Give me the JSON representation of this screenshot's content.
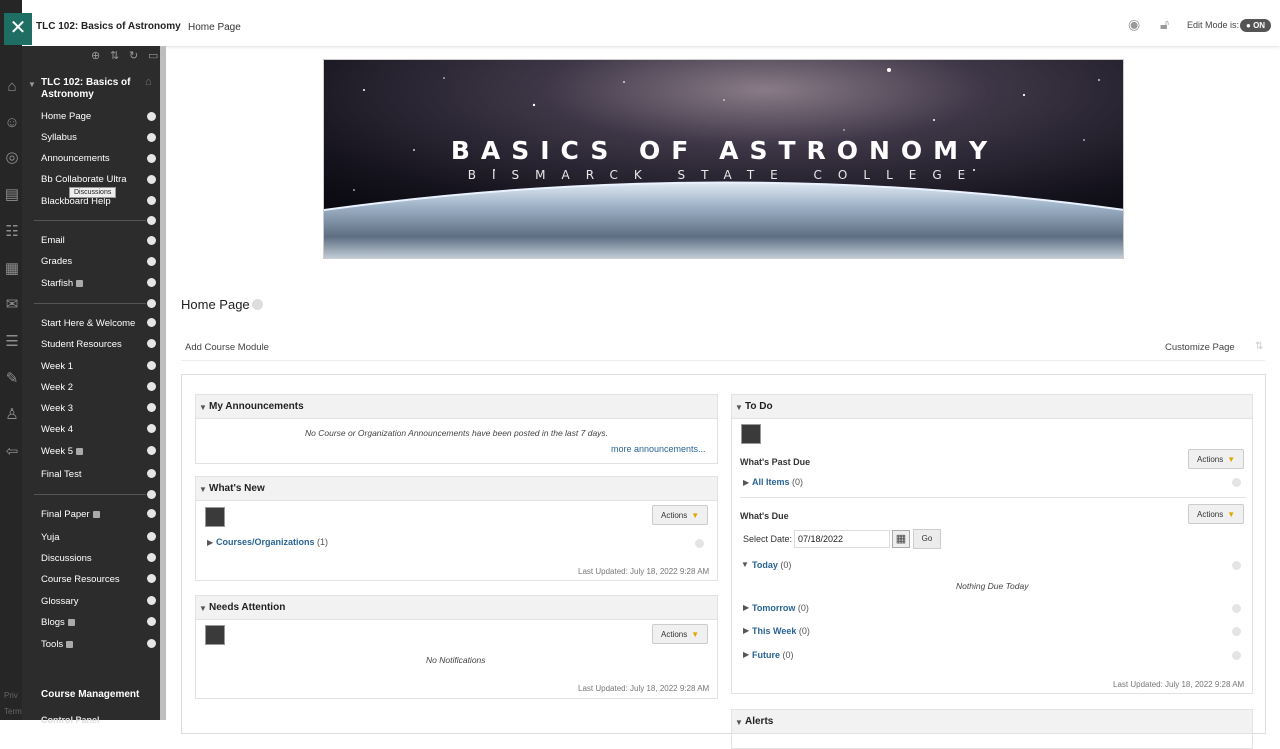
{
  "topbar": {
    "course_title": "TLC 102: Basics of Astronomy",
    "breadcrumb": "Home Page",
    "edit_mode_label": "Edit Mode is:",
    "edit_mode_value": "ON"
  },
  "rail": {
    "close_glyph": "✕",
    "footer_1": "Priv",
    "footer_2": "Term",
    "icons": [
      "institution-icon",
      "profile-icon",
      "globe-icon",
      "courses-icon",
      "groups-icon",
      "calendar-icon",
      "messages-icon",
      "grades-icon",
      "tools-icon",
      "user-icon",
      "sign-out-icon"
    ]
  },
  "menu": {
    "course": "TLC 102: Basics of Astronomy",
    "items": [
      {
        "label": "Home Page"
      },
      {
        "label": "Syllabus"
      },
      {
        "label": "Announcements"
      },
      {
        "label": "Bb Collaborate Ultra"
      },
      {
        "label": "Blackboard Help"
      },
      {
        "label": "Email"
      },
      {
        "label": "Grades"
      },
      {
        "label": "Starfish"
      },
      {
        "label": "Start Here & Welcome"
      },
      {
        "label": "Student Resources"
      },
      {
        "label": "Week 1"
      },
      {
        "label": "Week 2"
      },
      {
        "label": "Week 3"
      },
      {
        "label": "Week 4"
      },
      {
        "label": "Week 5"
      },
      {
        "label": "Final Test"
      },
      {
        "label": "Final Paper"
      },
      {
        "label": "Yuja"
      },
      {
        "label": "Discussions"
      },
      {
        "label": "Course Resources"
      },
      {
        "label": "Glossary"
      },
      {
        "label": "Blogs"
      },
      {
        "label": "Tools"
      }
    ],
    "tooltip": "Discussions",
    "course_management": "Course Management",
    "control_panel": "Control Panel"
  },
  "banner": {
    "title": "BASICS OF ASTRONOMY",
    "subtitle": "BISMARCK STATE COLLEGE"
  },
  "page": {
    "heading": "Home Page",
    "add_module": "Add Course Module",
    "customize": "Customize Page"
  },
  "modules": {
    "announcements": {
      "title": "My Announcements",
      "empty": "No Course or Organization Announcements have been posted in the last 7 days.",
      "more": "more announcements..."
    },
    "whats_new": {
      "title": "What's New",
      "actions": "Actions",
      "link": "Courses/Organizations",
      "count": "(1)",
      "updated": "Last Updated: July 18, 2022 9:28 AM"
    },
    "needs_attention": {
      "title": "Needs Attention",
      "actions": "Actions",
      "empty": "No Notifications",
      "updated": "Last Updated: July 18, 2022 9:28 AM"
    },
    "todo": {
      "title": "To Do",
      "past_due_title": "What's Past Due",
      "actions": "Actions",
      "all_items": "All Items",
      "all_items_count": "(0)",
      "due_title": "What's Due",
      "select_date_label": "Select Date:",
      "date_value": "07/18/2022",
      "go": "Go",
      "today": "Today",
      "today_count": "(0)",
      "nothing_due": "Nothing Due Today",
      "tomorrow": "Tomorrow",
      "tomorrow_count": "(0)",
      "this_week": "This Week",
      "this_week_count": "(0)",
      "future": "Future",
      "future_count": "(0)",
      "updated": "Last Updated: July 18, 2022 9:28 AM"
    },
    "alerts": {
      "title": "Alerts"
    }
  },
  "colors": {
    "menu_bg": "#2c2c2c",
    "rail_bg": "#262626",
    "close_bg": "#1f6e64",
    "link": "#2a6496",
    "action_arrow": "#e0a800"
  }
}
